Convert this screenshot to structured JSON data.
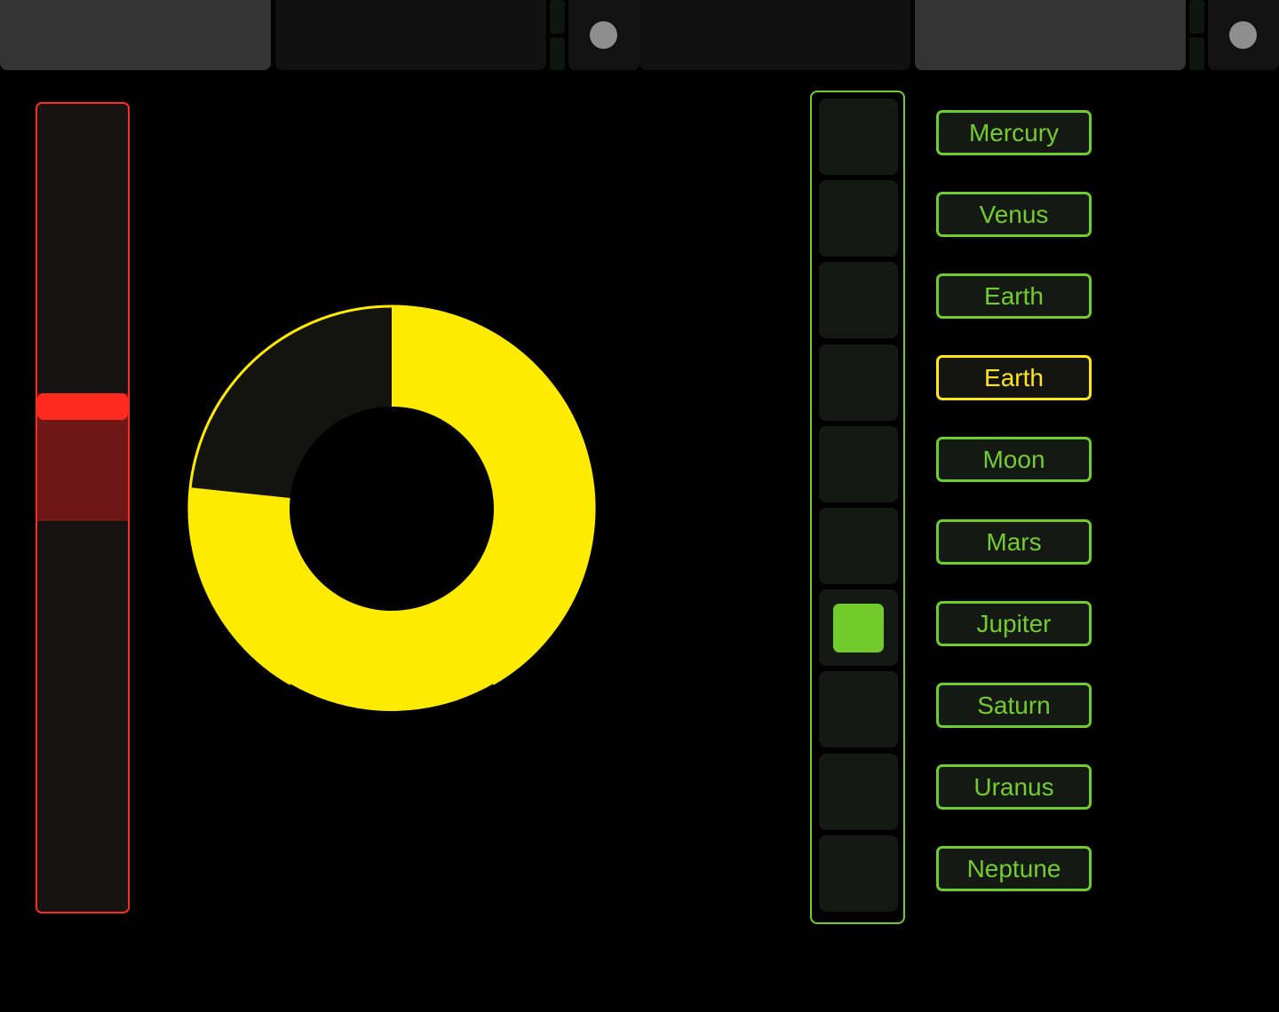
{
  "colors": {
    "background": "#000000",
    "fader_accent": "#ff2a1f",
    "fader_zone": "#6e1716",
    "knob_accent": "#ffeb00",
    "knob_track": "#13130f",
    "radio_accent": "#72cb2b",
    "planet_text": "#74cc2f",
    "planet_selected": "#ffe61a",
    "tab_light": "#343434",
    "tab_dark": "#111111",
    "record_dot": "#8e8e8e"
  },
  "topbar": {
    "tabs": [
      {
        "id": "tab-1",
        "style": "light"
      },
      {
        "id": "tab-2",
        "style": "dark"
      },
      {
        "id": "tab-3",
        "style": "dark"
      },
      {
        "id": "tab-4",
        "style": "light"
      }
    ],
    "record_buttons": [
      {
        "icon": "circle-dot-icon"
      },
      {
        "icon": "circle-dot-icon"
      }
    ]
  },
  "fader": {
    "value": 0.63,
    "zone_low": 0.5,
    "zone_high": 0.63
  },
  "knob": {
    "value": 0.22
  },
  "radio": {
    "count": 10,
    "selected_index": 6
  },
  "planets": {
    "selected_index": 3,
    "items": [
      {
        "label": "Mercury"
      },
      {
        "label": "Venus"
      },
      {
        "label": "Earth"
      },
      {
        "label": "Earth"
      },
      {
        "label": "Moon"
      },
      {
        "label": "Mars"
      },
      {
        "label": "Jupiter"
      },
      {
        "label": "Saturn"
      },
      {
        "label": "Uranus"
      },
      {
        "label": "Neptune"
      }
    ]
  }
}
